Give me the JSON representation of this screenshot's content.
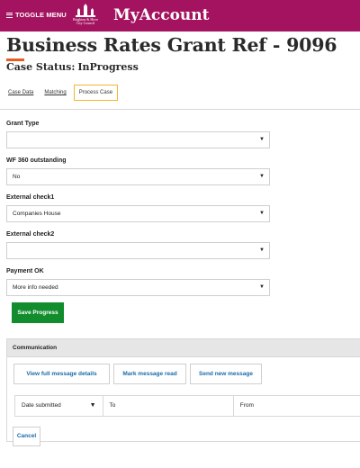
{
  "header": {
    "toggle_menu_label": "TOGGLE MENU",
    "logo_text": [
      "Brighton & Hove",
      "City Council"
    ],
    "brand": "MyAccount",
    "brand_color": "#a4135f"
  },
  "page": {
    "title": "Business Rates Grant Ref - 9096",
    "case_status_label": "Case Status:",
    "case_status_value": "InProgress"
  },
  "tabs": [
    {
      "label": "Case Data",
      "active": false
    },
    {
      "label": "Matching",
      "active": false
    },
    {
      "label": "Process Case",
      "active": true
    }
  ],
  "form": {
    "fields": [
      {
        "label": "Grant Type",
        "value": ""
      },
      {
        "label": "WF 360 outstanding",
        "value": "No"
      },
      {
        "label": "External check1",
        "value": "Companies House"
      },
      {
        "label": "External check2",
        "value": ""
      },
      {
        "label": "Payment OK",
        "value": "More info needed"
      }
    ],
    "dropdown_icon": "▼",
    "save_label": "Save Progress"
  },
  "communication": {
    "header": "Communication",
    "buttons": [
      "View full message details",
      "Mark message read",
      "Send new message"
    ],
    "columns": [
      "Date submitted",
      "To",
      "From"
    ],
    "sort_icon": "▼",
    "cancel_label": "Cancel"
  }
}
